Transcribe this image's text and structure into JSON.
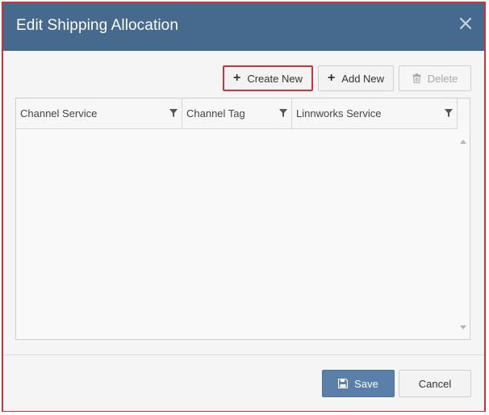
{
  "dialog": {
    "title": "Edit Shipping Allocation",
    "close_icon": "close-icon"
  },
  "toolbar": {
    "create_new_label": "Create New",
    "add_new_label": "Add New",
    "delete_label": "Delete"
  },
  "grid": {
    "columns": [
      {
        "label": "Channel Service"
      },
      {
        "label": "Channel Tag"
      },
      {
        "label": "Linnworks Service"
      }
    ],
    "rows": []
  },
  "footer": {
    "save_label": "Save",
    "cancel_label": "Cancel"
  },
  "colors": {
    "header_bg": "#46698e",
    "primary_button": "#5a7fa8",
    "highlight_border": "#d0323a"
  }
}
